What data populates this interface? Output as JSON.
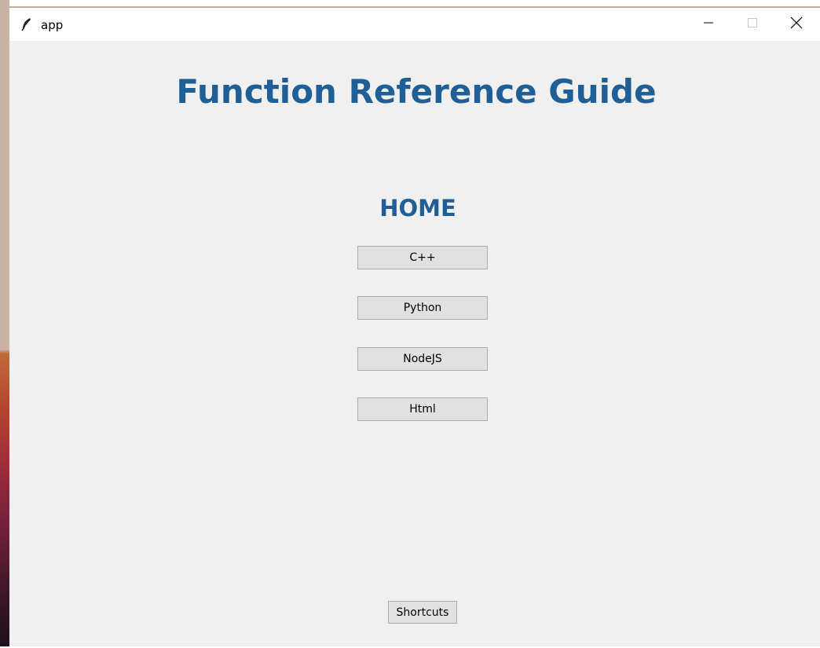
{
  "window": {
    "title": "app",
    "icon": "feather-icon",
    "controls": [
      "minimize-icon",
      "maximize-icon",
      "close-icon"
    ]
  },
  "main": {
    "title": "Function Reference Guide",
    "section_title": "HOME",
    "buttons": [
      {
        "label": "C++"
      },
      {
        "label": "Python"
      },
      {
        "label": "NodeJS"
      },
      {
        "label": "Html"
      }
    ],
    "shortcuts_label": "Shortcuts"
  },
  "colors": {
    "heading": "#1f5f96",
    "background": "#f0f0f0",
    "button_face": "#e1e1e1",
    "button_border": "#adadad"
  }
}
